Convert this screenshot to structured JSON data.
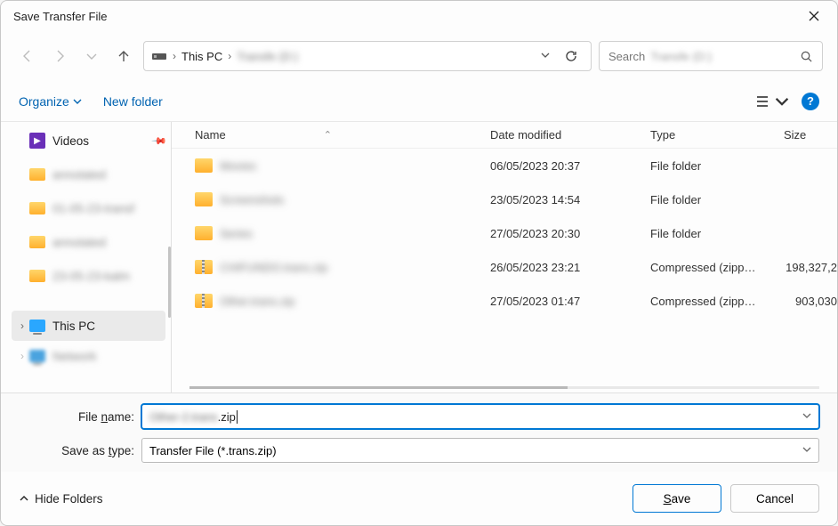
{
  "window": {
    "title": "Save Transfer File"
  },
  "breadcrumb": {
    "root": "This PC",
    "chevron": "›",
    "drive_blur": "Transfe (D:)"
  },
  "search": {
    "prefix": "Search",
    "blur": "Transfe (D:)"
  },
  "toolbar": {
    "organize": "Organize",
    "newfolder": "New folder",
    "help": "?"
  },
  "columns": {
    "name": "Name",
    "date": "Date modified",
    "type": "Type",
    "size": "Size"
  },
  "sidebar": {
    "videos": "Videos",
    "items": [
      {
        "blur": "annotated"
      },
      {
        "blur": "01-05-23-transf"
      },
      {
        "blur": "annotated"
      },
      {
        "blur": "23-05-23-kalm"
      }
    ],
    "thispc": "This PC",
    "network_blur": "Network"
  },
  "files": [
    {
      "icon": "folder",
      "name_blur": "Movies",
      "date": "06/05/2023 20:37",
      "type": "File folder",
      "size": ""
    },
    {
      "icon": "folder",
      "name_blur": "Screenshots",
      "date": "23/05/2023 14:54",
      "type": "File folder",
      "size": ""
    },
    {
      "icon": "folder",
      "name_blur": "Series",
      "date": "27/05/2023 20:30",
      "type": "File folder",
      "size": ""
    },
    {
      "icon": "zip",
      "name_blur": "CHIFUNDO.trans.zip",
      "date": "26/05/2023 23:21",
      "type": "Compressed (zipp…",
      "size": "198,327,2"
    },
    {
      "icon": "zip",
      "name_blur": "Other.trans.zip",
      "date": "27/05/2023 01:47",
      "type": "Compressed (zipp…",
      "size": "903,030"
    }
  ],
  "form": {
    "filename_label_pre": "File ",
    "filename_label_ul": "n",
    "filename_label_post": "ame:",
    "filename_blur": "Other-2.trans",
    "filename_suffix": ".zip",
    "saveastype_label_pre": "Save as ",
    "saveastype_label_ul": "t",
    "saveastype_label_post": "ype:",
    "saveastype_value": "Transfer File (*.trans.zip)"
  },
  "footer": {
    "hide": "Hide Folders",
    "save_ul": "S",
    "save_post": "ave",
    "cancel": "Cancel"
  }
}
